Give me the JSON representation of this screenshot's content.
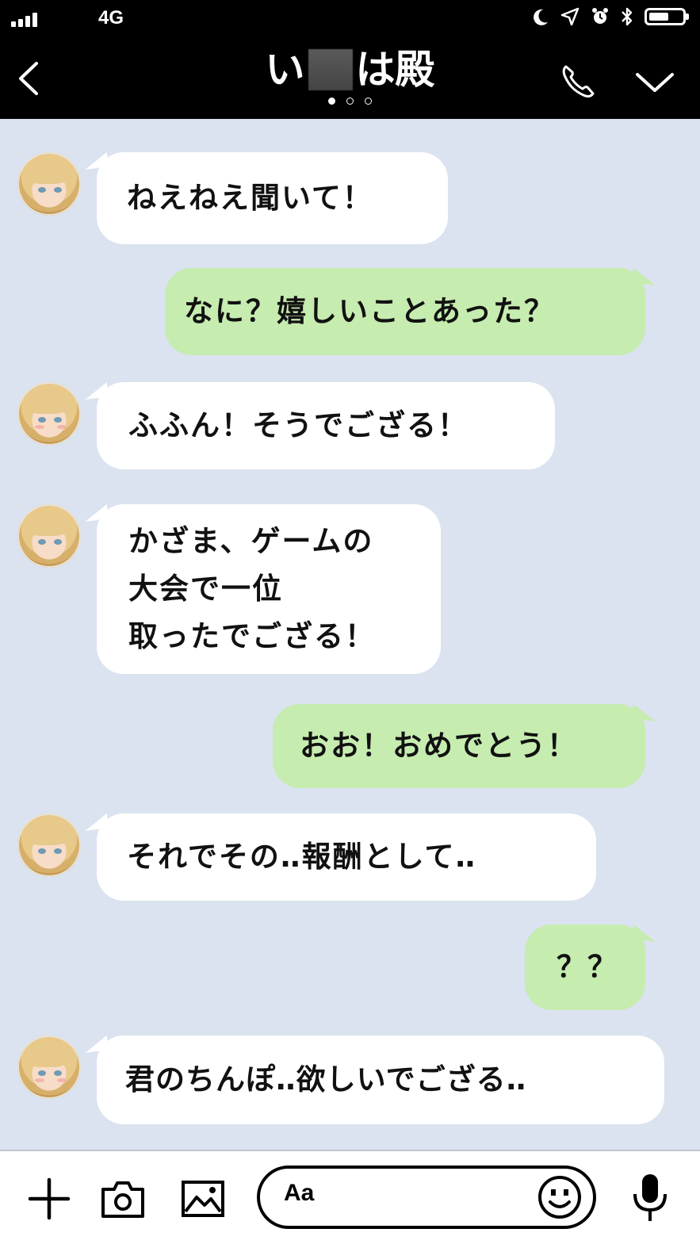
{
  "status_bar": {
    "network": "4G",
    "battery_level": 0.6,
    "icons": [
      "signal-icon",
      "moon-icon",
      "location-icon",
      "alarm-icon",
      "bluetooth-icon",
      "battery-icon"
    ]
  },
  "header": {
    "title_prefix": "い",
    "title_suffix": "は殿",
    "page_indicator": {
      "count": 3,
      "active": 0
    },
    "icons": [
      "back-icon",
      "phone-icon",
      "chevron-down-icon"
    ]
  },
  "messages": [
    {
      "sender": "them",
      "lines": [
        "ねえねえ聞いて！"
      ]
    },
    {
      "sender": "me",
      "lines": [
        "なに？嬉しいことあった？"
      ]
    },
    {
      "sender": "them",
      "lines": [
        "ふふん！そうでござる！"
      ]
    },
    {
      "sender": "them",
      "lines": [
        "かざま、ゲームの",
        "大会で一位",
        "取ったでござる！"
      ]
    },
    {
      "sender": "me",
      "lines": [
        "おお！おめでとう！"
      ]
    },
    {
      "sender": "them",
      "lines": [
        "それでその‥報酬として‥"
      ]
    },
    {
      "sender": "me",
      "lines": [
        "？？"
      ]
    },
    {
      "sender": "them",
      "lines": [
        "君のちんぽ‥欲しいでござる‥"
      ]
    }
  ],
  "input_bar": {
    "placeholder": "Aa",
    "icons": [
      "plus-icon",
      "camera-icon",
      "image-icon",
      "emoji-icon",
      "microphone-icon"
    ]
  },
  "colors": {
    "background": "#dae3ef",
    "bar": "#000000",
    "incoming_bubble": "#ffffff",
    "outgoing_bubble": "#c6ecb0"
  }
}
